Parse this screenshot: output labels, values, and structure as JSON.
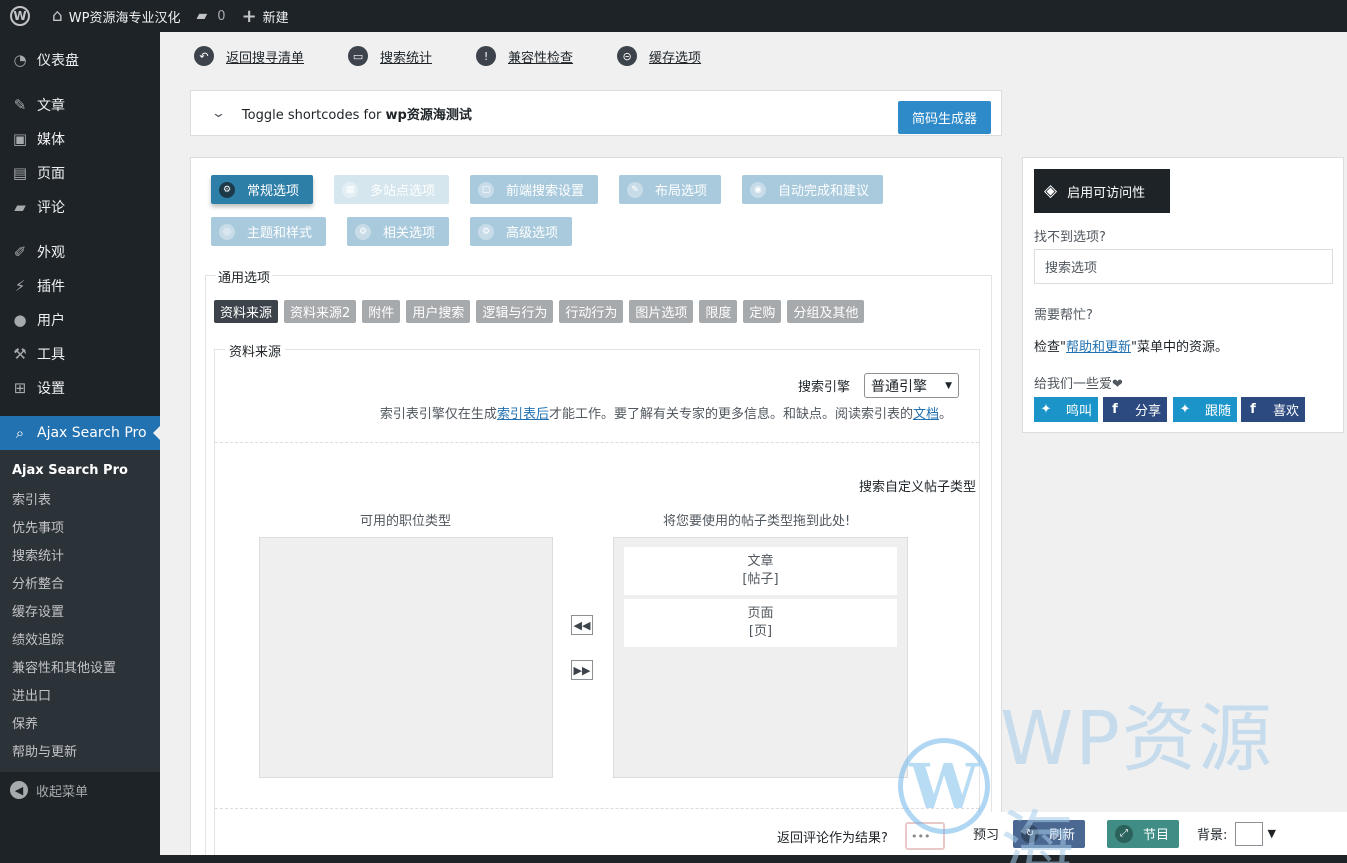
{
  "adminbar": {
    "site_name": "WP资源海专业汉化",
    "comments_count": "0",
    "new_label": "新建"
  },
  "sidebar": {
    "items": [
      {
        "label": "仪表盘",
        "icon": "dashboard-icon"
      },
      {
        "label": "文章",
        "icon": "pin-icon"
      },
      {
        "label": "媒体",
        "icon": "media-icon"
      },
      {
        "label": "页面",
        "icon": "page-icon"
      },
      {
        "label": "评论",
        "icon": "comment-icon"
      },
      {
        "label": "外观",
        "icon": "brush-icon"
      },
      {
        "label": "插件",
        "icon": "plugin-icon"
      },
      {
        "label": "用户",
        "icon": "user-icon"
      },
      {
        "label": "工具",
        "icon": "wrench-icon"
      },
      {
        "label": "设置",
        "icon": "settings-icon"
      },
      {
        "label": "Ajax Search Pro",
        "icon": "search-icon"
      }
    ],
    "submenu": [
      "Ajax Search Pro",
      "索引表",
      "优先事项",
      "搜索统计",
      "分析整合",
      "缓存设置",
      "绩效追踪",
      "兼容性和其他设置",
      "进出口",
      "保养",
      "帮助与更新"
    ],
    "collapse_label": "收起菜单"
  },
  "toplinks": [
    {
      "label": "返回搜寻清单",
      "icon": "back-arrow-icon"
    },
    {
      "label": "搜索统计",
      "icon": "keyboard-icon"
    },
    {
      "label": "兼容性检查",
      "icon": "exclamation-icon"
    },
    {
      "label": "缓存选项",
      "icon": "cache-icon"
    }
  ],
  "shortcodes": {
    "prefix": "Toggle shortcodes for ",
    "name": "wp资源海测试",
    "generator_label": "简码生成器"
  },
  "tabs": [
    {
      "label": "常规选项",
      "state": "active"
    },
    {
      "label": "多站点选项",
      "state": "disabled"
    },
    {
      "label": "前端搜索设置",
      "state": "normal"
    },
    {
      "label": "布局选项",
      "state": "normal"
    },
    {
      "label": "自动完成和建议",
      "state": "normal"
    },
    {
      "label": "主题和样式",
      "state": "normal"
    },
    {
      "label": "相关选项",
      "state": "normal"
    },
    {
      "label": "高级选项",
      "state": "normal"
    }
  ],
  "general": {
    "legend": "通用选项",
    "subtabs": [
      "资料来源",
      "资料来源2",
      "附件",
      "用户搜索",
      "逻辑与行为",
      "行动行为",
      "图片选项",
      "限度",
      "定购",
      "分组及其他"
    ],
    "source_legend": "资料来源",
    "engine_label": "搜索引擎",
    "engine_value": "普通引擎",
    "note_before": "索引表引擎仅在生成",
    "note_link": "索引表后",
    "note_middle": "才能工作。要了解有关专家的更多信息。和缺点。阅读索引表的",
    "note_link2": "文档",
    "note_end": "。",
    "cpt_label": "搜索自定义帖子类型",
    "available_title": "可用的职位类型",
    "drop_title": "将您要使用的帖子类型拖到此处!",
    "selected_types": [
      {
        "name": "文章",
        "slug": "[帖子]"
      },
      {
        "name": "页面",
        "slug": "[页]"
      }
    ],
    "return_comments_label": "返回评论作为结果?"
  },
  "rightpanel": {
    "accessibility_label": "启用可访问性",
    "cant_find": "找不到选项?",
    "search_placeholder": "搜索选项",
    "need_help": "需要帮忙?",
    "check_before": "检查\"",
    "check_link": "帮助和更新",
    "check_after": "\"菜单中的资源。",
    "love": "给我们一些爱❤",
    "social": [
      {
        "label": "鸣叫",
        "icon": "twitter-icon",
        "color": "#1b95c9"
      },
      {
        "label": "分享",
        "icon": "facebook-icon",
        "color": "#2c4a7f"
      },
      {
        "label": "跟随",
        "icon": "twitter-icon",
        "color": "#1b95c9"
      },
      {
        "label": "喜欢",
        "icon": "facebook-icon",
        "color": "#2c4a7f"
      }
    ]
  },
  "floatbar": {
    "preview_label": "预习",
    "refresh_label": "刷新",
    "section_label": "节目",
    "background_label": "背景:"
  },
  "watermark": {
    "text": "WP资源海"
  },
  "colors": {
    "accent": "#2271b1",
    "admin_dark": "#1d2327",
    "tab_active": "#2e7fa8",
    "tab_normal": "#a9cadc"
  }
}
